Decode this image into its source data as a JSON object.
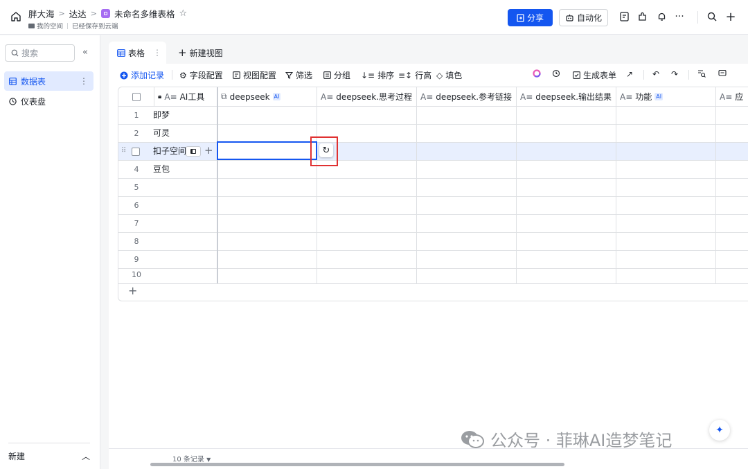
{
  "header": {
    "breadcrumbs": [
      "胖大海",
      "达达",
      "未命名多维表格"
    ],
    "workspace": "我的空间",
    "save_status": "已经保存到云端",
    "share_label": "分享",
    "automation_label": "自动化"
  },
  "sidebar": {
    "search_placeholder": "搜索",
    "items": [
      {
        "label": "数据表",
        "active": true
      },
      {
        "label": "仪表盘",
        "active": false
      }
    ],
    "new_label": "新建"
  },
  "tabs": {
    "active_label": "表格",
    "new_view_label": "新建视图"
  },
  "toolbar": {
    "add_record": "添加记录",
    "field_config": "字段配置",
    "view_config": "视图配置",
    "filter": "筛选",
    "group": "分组",
    "sort": "排序",
    "row_height": "行高",
    "fill_color": "填色",
    "generate_form": "生成表单"
  },
  "table": {
    "columns": [
      {
        "label": "AI工具",
        "ai": false
      },
      {
        "label": "deepseek",
        "ai": true
      },
      {
        "label": "deepseek.思考过程",
        "ai": false
      },
      {
        "label": "deepseek.参考链接",
        "ai": false
      },
      {
        "label": "deepseek.输出结果",
        "ai": false
      },
      {
        "label": "功能",
        "ai": true
      },
      {
        "label": "应",
        "ai": false
      }
    ],
    "ai_tag": "AI",
    "rows": [
      {
        "num": "1",
        "name": "即梦"
      },
      {
        "num": "2",
        "name": "可灵"
      },
      {
        "num": "",
        "name": "扣子空间"
      },
      {
        "num": "4",
        "name": "豆包"
      },
      {
        "num": "5",
        "name": ""
      },
      {
        "num": "6",
        "name": ""
      },
      {
        "num": "7",
        "name": ""
      },
      {
        "num": "8",
        "name": ""
      },
      {
        "num": "9",
        "name": ""
      },
      {
        "num": "10",
        "name": ""
      }
    ]
  },
  "footer": {
    "record_count": "10 条记录"
  },
  "watermark": "公众号 · 菲琳AI造梦笔记",
  "colors": {
    "primary": "#1456f0",
    "highlight_box": "#e03131",
    "selected_row": "#e8effe"
  }
}
